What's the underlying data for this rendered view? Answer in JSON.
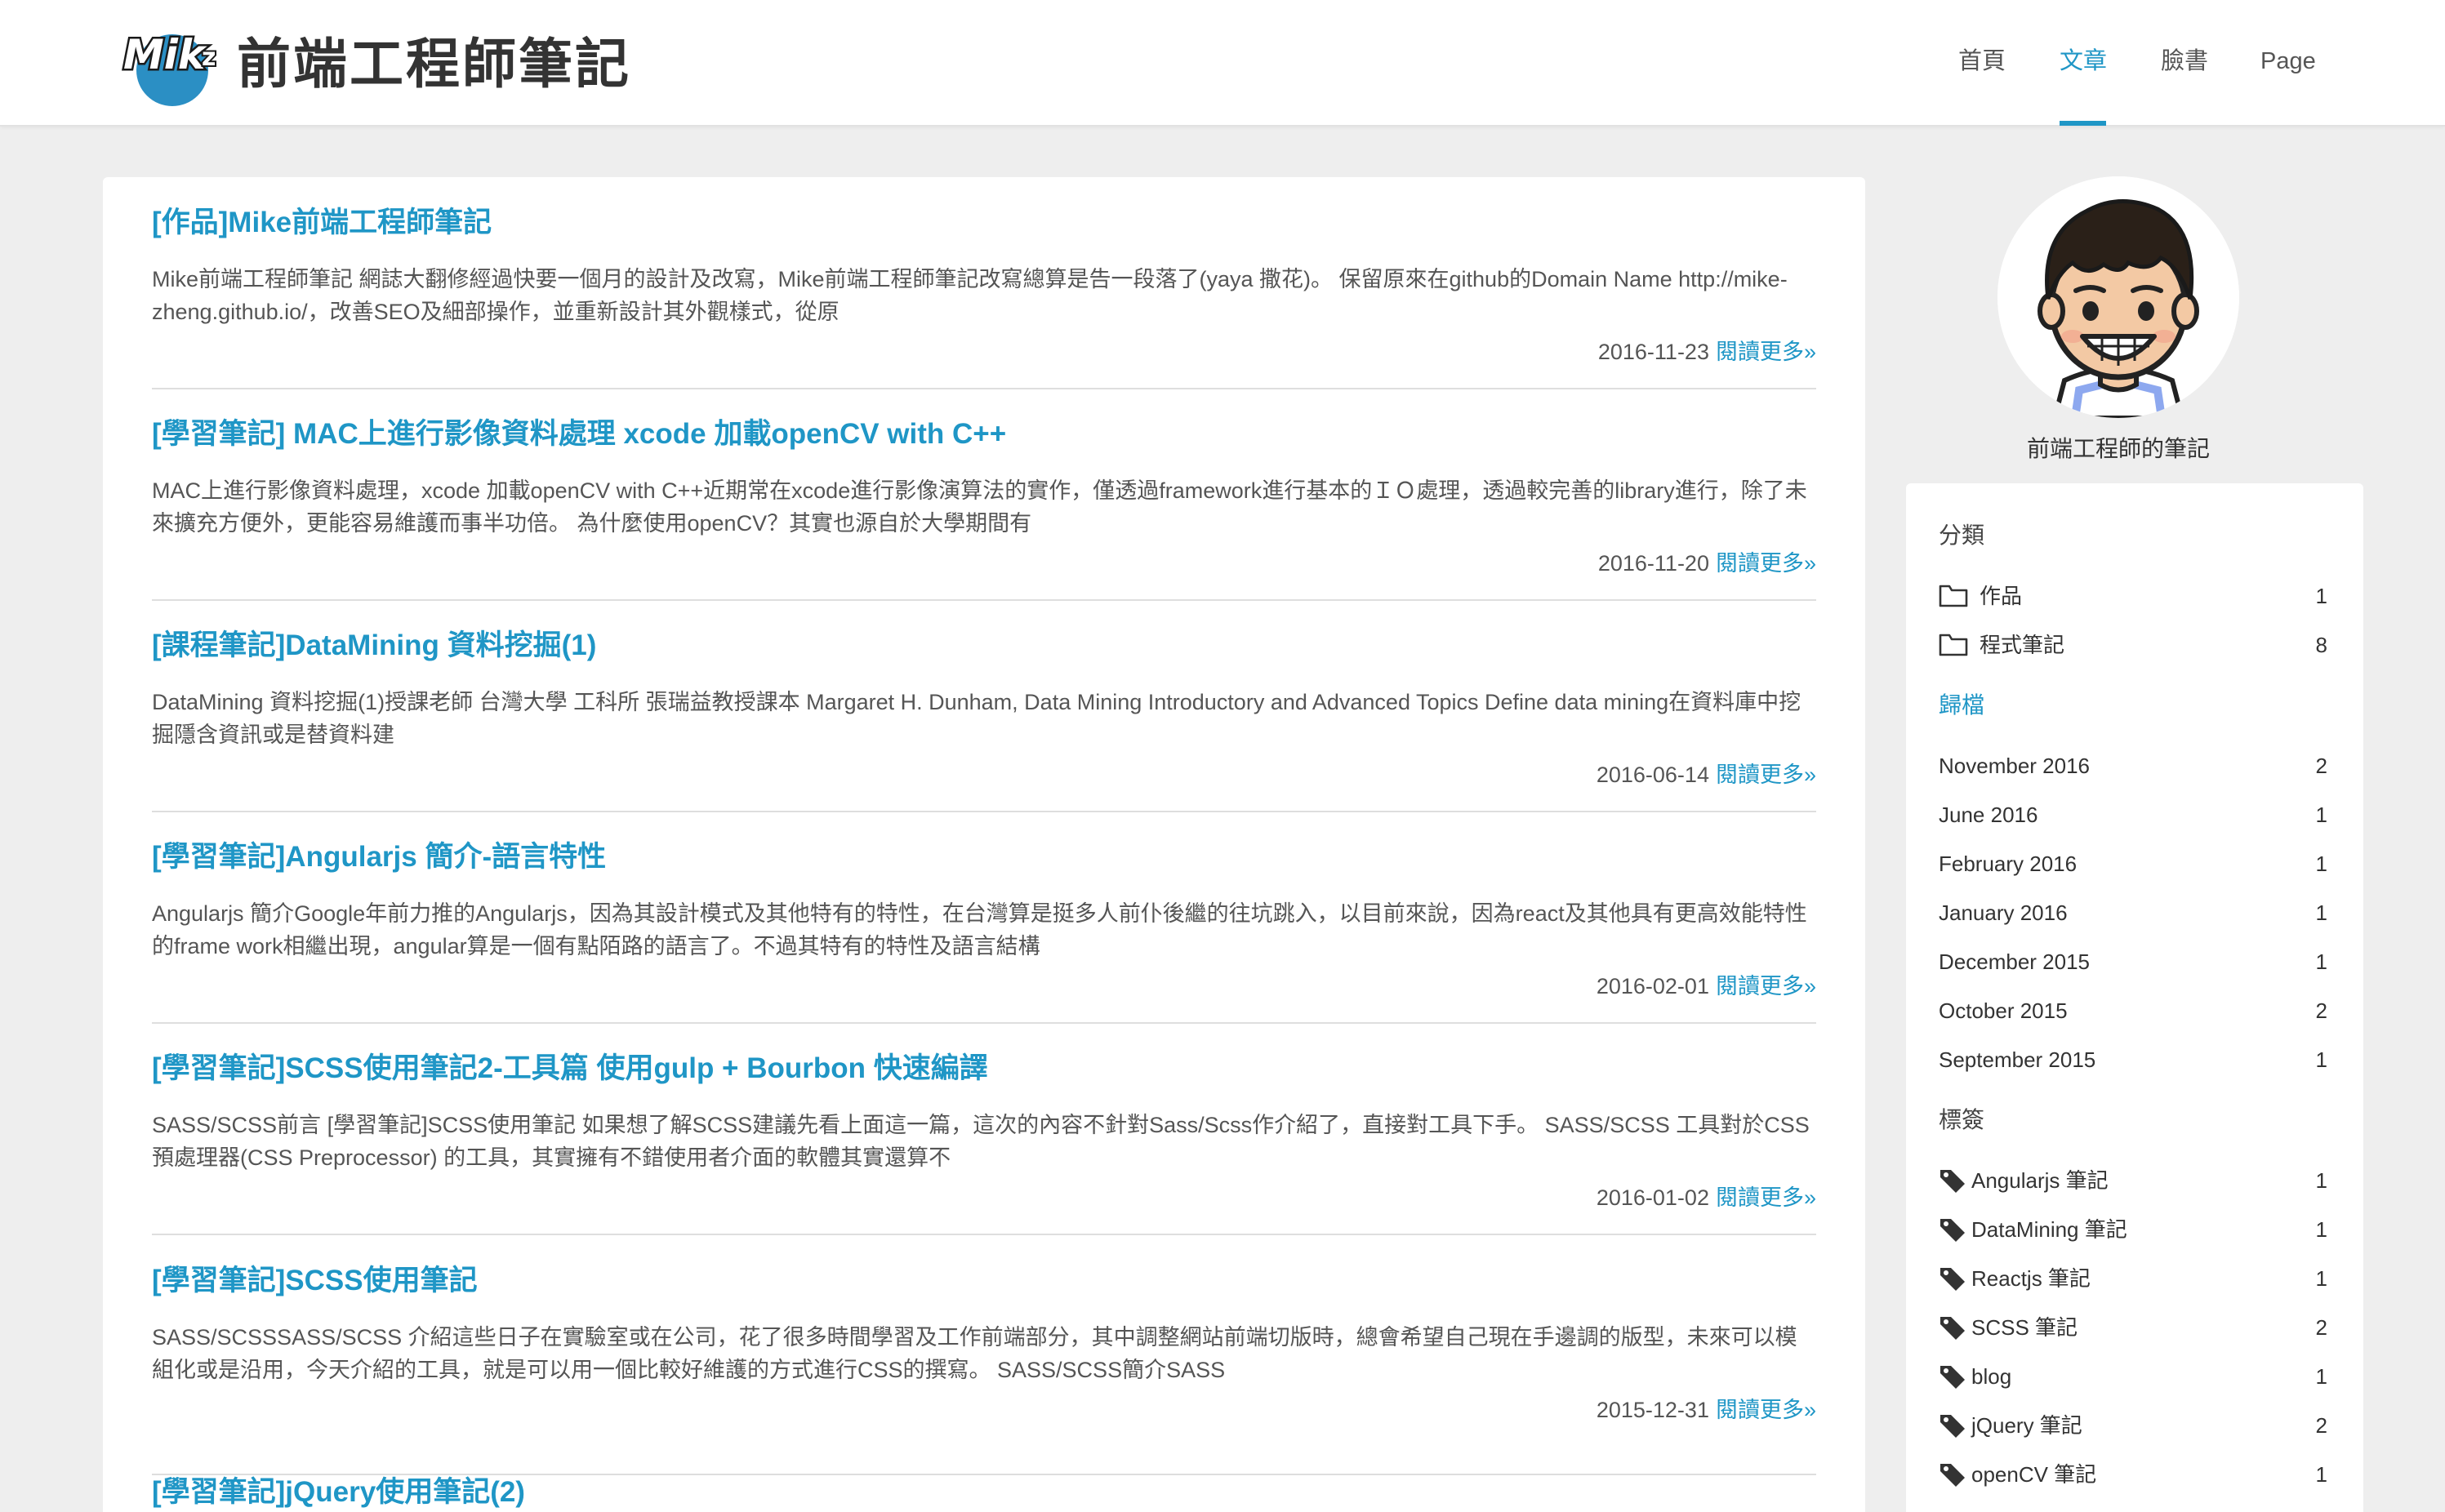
{
  "site": {
    "logo_text": "Mikz",
    "title": "前端工程師筆記"
  },
  "nav": {
    "items": [
      {
        "label": "首頁"
      },
      {
        "label": "文章"
      },
      {
        "label": "臉書"
      },
      {
        "label": "Page"
      }
    ],
    "active": "文章"
  },
  "posts": [
    {
      "title": "[作品]Mike前端工程師筆記",
      "excerpt": "Mike前端工程師筆記 網誌大翻修經過快要一個月的設計及改寫，Mike前端工程師筆記改寫總算是告一段落了(yaya 撒花)。 保留原來在github的Domain Name http://mike-zheng.github.io/，改善SEO及細部操作，並重新設計其外觀樣式，從原",
      "date": "2016-11-23",
      "more": "閱讀更多»"
    },
    {
      "title": "[學習筆記] MAC上進行影像資料處理 xcode 加載openCV with C++",
      "excerpt": "MAC上進行影像資料處理，xcode 加載openCV with C++近期常在xcode進行影像演算法的實作，僅透過framework進行基本的ＩＯ處理，透過較完善的library進行，除了未來擴充方便外，更能容易維護而事半功倍。 為什麼使用openCV？其實也源自於大學期間有",
      "date": "2016-11-20",
      "more": "閱讀更多»"
    },
    {
      "title": "[課程筆記]DataMining 資料挖掘(1)",
      "excerpt": "DataMining 資料挖掘(1)授課老師 台灣大學 工科所 張瑞益教授課本 Margaret H. Dunham, Data Mining Introductory and Advanced Topics Define data mining在資料庫中挖掘隱含資訊或是替資料建",
      "date": "2016-06-14",
      "more": "閱讀更多»"
    },
    {
      "title": "[學習筆記]Angularjs 簡介-語言特性",
      "excerpt": "Angularjs 簡介Google年前力推的Angularjs，因為其設計模式及其他特有的特性，在台灣算是挺多人前仆後繼的往坑跳入，以目前來說，因為react及其他具有更高效能特性的frame work相繼出現，angular算是一個有點陌路的語言了。不過其特有的特性及語言結構",
      "date": "2016-02-01",
      "more": "閱讀更多»"
    },
    {
      "title": "[學習筆記]SCSS使用筆記2-工具篇 使用gulp + Bourbon 快速編譯",
      "excerpt": "SASS/SCSS前言 [學習筆記]SCSS使用筆記 如果想了解SCSS建議先看上面這一篇，這次的內容不針對Sass/Scss作介紹了，直接對工具下手。 SASS/SCSS 工具對於CSS預處理器(CSS Preprocessor) 的工具，其實擁有不錯使用者介面的軟體其實還算不",
      "date": "2016-01-02",
      "more": "閱讀更多»"
    },
    {
      "title": "[學習筆記]SCSS使用筆記",
      "excerpt": "SASS/SCSSSASS/SCSS 介紹這些日子在實驗室或在公司，花了很多時間學習及工作前端部分，其中調整網站前端切版時，總會希望自己現在手邊調的版型，未來可以模組化或是沿用，今天介紹的工具，就是可以用一個比較好維護的方式進行CSS的撰寫。 SASS/SCSS簡介SASS",
      "date": "2015-12-31",
      "more": "閱讀更多»"
    },
    {
      "title": "[學習筆記]jQuery使用筆記(2)",
      "excerpt": "",
      "date": "",
      "more": ""
    }
  ],
  "sidebar": {
    "caption": "前端工程師的筆記",
    "categories_title": "分類",
    "categories": [
      {
        "label": "作品",
        "count": "1"
      },
      {
        "label": "程式筆記",
        "count": "8"
      }
    ],
    "archives_title": "歸檔",
    "archives": [
      {
        "label": "November 2016",
        "count": "2"
      },
      {
        "label": "June 2016",
        "count": "1"
      },
      {
        "label": "February 2016",
        "count": "1"
      },
      {
        "label": "January 2016",
        "count": "1"
      },
      {
        "label": "December 2015",
        "count": "1"
      },
      {
        "label": "October 2015",
        "count": "2"
      },
      {
        "label": "September 2015",
        "count": "1"
      }
    ],
    "tags_title": "標簽",
    "tags": [
      {
        "label": "Angularjs 筆記",
        "count": "1"
      },
      {
        "label": "DataMining 筆記",
        "count": "1"
      },
      {
        "label": "Reactjs 筆記",
        "count": "1"
      },
      {
        "label": "SCSS 筆記",
        "count": "2"
      },
      {
        "label": "blog",
        "count": "1"
      },
      {
        "label": "jQuery 筆記",
        "count": "2"
      },
      {
        "label": "openCV 筆記",
        "count": "1"
      }
    ]
  },
  "colors": {
    "accent": "#1f96c6",
    "background": "#eeeeee",
    "card": "#ffffff"
  }
}
